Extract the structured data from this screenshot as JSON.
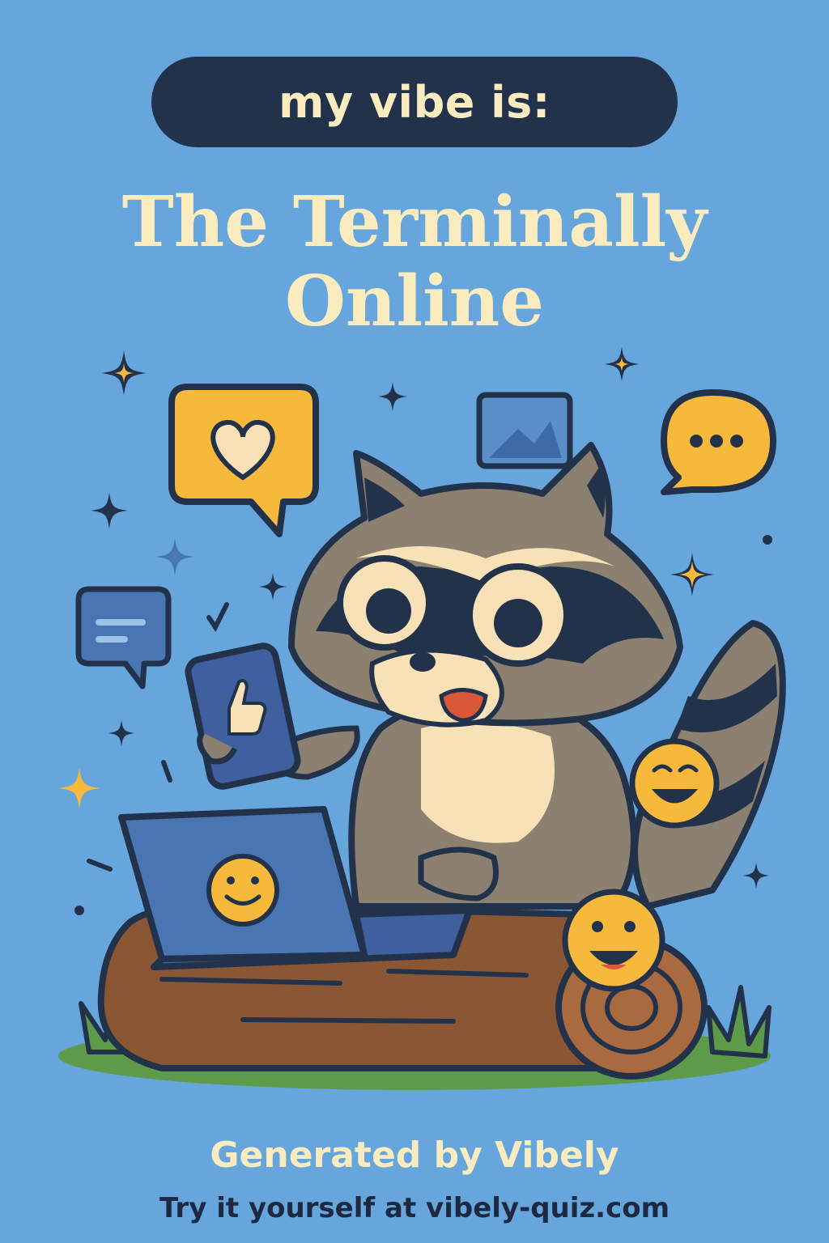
{
  "header": {
    "pill_text": "my vibe is:",
    "title_line1": "The Terminally",
    "title_line2": "Online"
  },
  "illustration": {
    "subject": "raccoon-icon",
    "items": [
      "heart-bubble-icon",
      "image-icon",
      "ellipsis-bubble-icon",
      "message-bubble-icon",
      "phone-thumbs-up-icon",
      "laptop-smiley-icon",
      "laughing-emoji-icon",
      "smiling-emoji-icon",
      "log-icon",
      "sparkle-icon"
    ]
  },
  "footer": {
    "generated_by": "Generated by Vibely",
    "cta": "Try it yourself at vibely-quiz.com"
  },
  "colors": {
    "background": "#66a6dd",
    "pill": "#22324a",
    "cream": "#fbecc0",
    "yellow": "#f6b93b",
    "dark": "#22324a"
  }
}
